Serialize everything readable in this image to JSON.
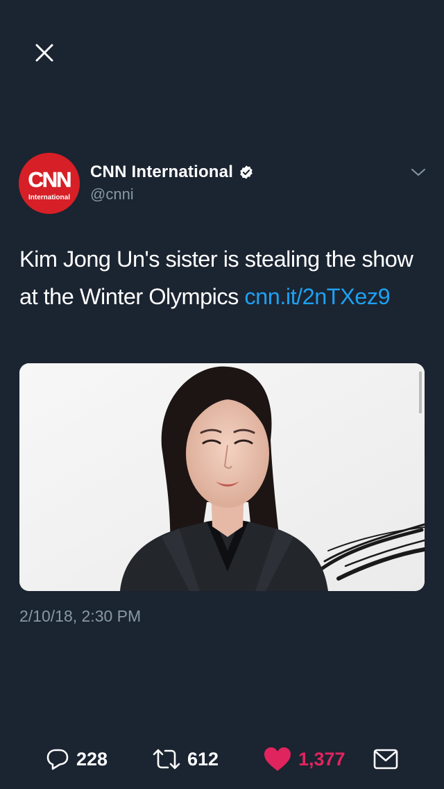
{
  "tweet": {
    "author": {
      "display_name": "CNN International",
      "handle": "@cnni",
      "verified": true,
      "avatar_logo_text": "CNN",
      "avatar_sub_text": "International",
      "avatar_color": "#d61f26"
    },
    "text": "Kim Jong Un's sister is stealing the show at the Winter Olympics ",
    "link": "cnn.it/2nTXez9",
    "timestamp": "2/10/18, 2:30 PM",
    "media": {
      "description_icon": "photo"
    }
  },
  "actions": {
    "reply": {
      "icon": "reply-icon",
      "count": "228"
    },
    "retweet": {
      "icon": "retweet-icon",
      "count": "612"
    },
    "like": {
      "icon": "heart-icon",
      "count": "1,377",
      "liked": true,
      "color": "#e0245e"
    },
    "share": {
      "icon": "share-icon"
    }
  },
  "colors": {
    "background": "#1b2431",
    "text": "#ffffff",
    "secondary": "#8899a6",
    "link": "#1da1f2",
    "like": "#e0245e"
  }
}
